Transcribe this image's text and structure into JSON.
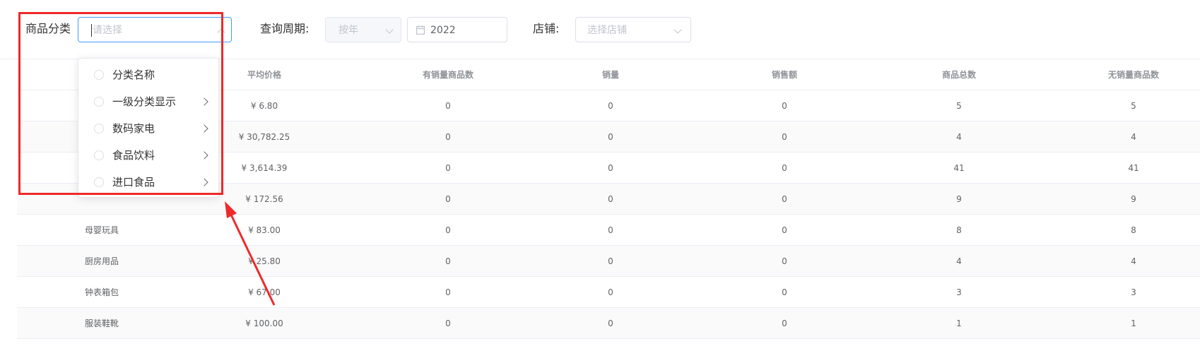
{
  "filters": {
    "category_label": "商品分类",
    "category_placeholder": "请选择",
    "period_label": "查询周期:",
    "period_type_placeholder": "按年",
    "year_value": "2022",
    "shop_label": "店铺:",
    "shop_placeholder": "选择店铺"
  },
  "dropdown": {
    "items": [
      {
        "label": "分类名称",
        "has_children": false
      },
      {
        "label": "一级分类显示",
        "has_children": true
      },
      {
        "label": "数码家电",
        "has_children": true
      },
      {
        "label": "食品饮料",
        "has_children": true
      },
      {
        "label": "进口食品",
        "has_children": true
      }
    ]
  },
  "table": {
    "headers": [
      "平均价格",
      "有销量商品数",
      "销量",
      "销售额",
      "商品总数",
      "无销量商品数"
    ],
    "rows": [
      {
        "name": "",
        "avg_price": "¥ 6.80",
        "sold_goods": "0",
        "sales": "0",
        "amount": "0",
        "total": "5",
        "unsold": "5"
      },
      {
        "name": "",
        "avg_price": "¥ 30,782.25",
        "sold_goods": "0",
        "sales": "0",
        "amount": "0",
        "total": "4",
        "unsold": "4"
      },
      {
        "name": "",
        "avg_price": "¥ 3,614.39",
        "sold_goods": "0",
        "sales": "0",
        "amount": "0",
        "total": "41",
        "unsold": "41"
      },
      {
        "name": "",
        "avg_price": "¥ 172.56",
        "sold_goods": "0",
        "sales": "0",
        "amount": "0",
        "total": "9",
        "unsold": "9"
      },
      {
        "name": "母婴玩具",
        "avg_price": "¥ 83.00",
        "sold_goods": "0",
        "sales": "0",
        "amount": "0",
        "total": "8",
        "unsold": "8"
      },
      {
        "name": "厨房用品",
        "avg_price": "¥ 25.80",
        "sold_goods": "0",
        "sales": "0",
        "amount": "0",
        "total": "4",
        "unsold": "4"
      },
      {
        "name": "钟表箱包",
        "avg_price": "¥ 67.00",
        "sold_goods": "0",
        "sales": "0",
        "amount": "0",
        "total": "3",
        "unsold": "3"
      },
      {
        "name": "服装鞋靴",
        "avg_price": "¥ 100.00",
        "sold_goods": "0",
        "sales": "0",
        "amount": "0",
        "total": "1",
        "unsold": "1"
      }
    ]
  },
  "colors": {
    "annotation": "#ee2a2a",
    "focus": "#409eff"
  },
  "icons": [
    "calendar-icon",
    "chevron-down-icon",
    "chevron-up-icon",
    "chevron-right-icon"
  ]
}
